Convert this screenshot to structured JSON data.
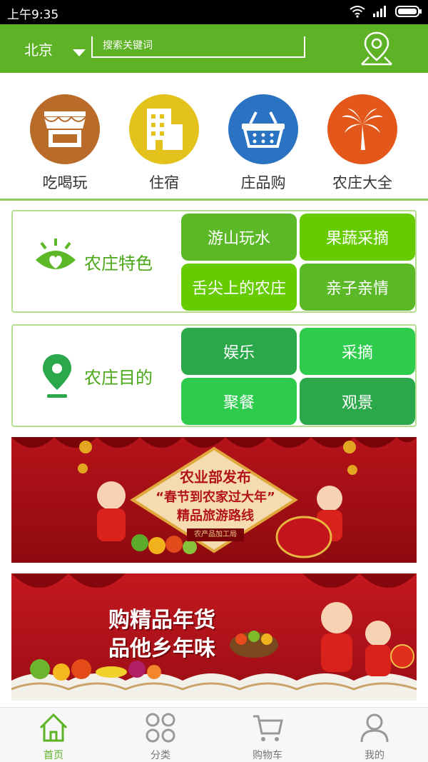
{
  "status_bar": {
    "time": "上午9:35"
  },
  "header": {
    "city": "北京",
    "search_placeholder": "搜索关键词"
  },
  "categories": [
    {
      "label": "吃喝玩",
      "color": "#b96c2a",
      "icon": "storefront-icon"
    },
    {
      "label": "住宿",
      "color": "#e3c21b",
      "icon": "building-icon"
    },
    {
      "label": "庄品购",
      "color": "#2a72c2",
      "icon": "basket-icon"
    },
    {
      "label": "农庄大全",
      "color": "#e3581a",
      "icon": "palm-tree-icon"
    }
  ],
  "feature_panel": {
    "title": "农庄特色",
    "icon": "eye-heart-icon",
    "tiles": [
      "游山玩水",
      "果蔬采摘",
      "舌尖上的农庄",
      "亲子亲情"
    ]
  },
  "destination_panel": {
    "title": "农庄目的",
    "icon": "location-pin-icon",
    "tiles": [
      "娱乐",
      "采摘",
      "聚餐",
      "观景"
    ]
  },
  "banners": [
    {
      "icon": "spring-festival-banner",
      "lines": [
        "农业部发布",
        "“春节到农家过大年”",
        "精品旅游路线"
      ],
      "footer": "农产品加工局"
    },
    {
      "icon": "new-year-goods-banner",
      "lines": [
        "购精品年货",
        "品他乡年味"
      ]
    }
  ],
  "bottom_nav": [
    {
      "label": "首页",
      "icon": "home-icon",
      "active": true
    },
    {
      "label": "分类",
      "icon": "grid-icon",
      "active": false
    },
    {
      "label": "购物车",
      "icon": "cart-icon",
      "active": false
    },
    {
      "label": "我的",
      "icon": "user-icon",
      "active": false
    }
  ],
  "colors": {
    "brand_green": "#5db325",
    "tile_green_light": "#5bb928",
    "tile_green_bright": "#66cc00",
    "tile_green_dark": "#2aa84a",
    "tile_green_vivid": "#2dcc4c",
    "banner_red": "#b5131a"
  }
}
